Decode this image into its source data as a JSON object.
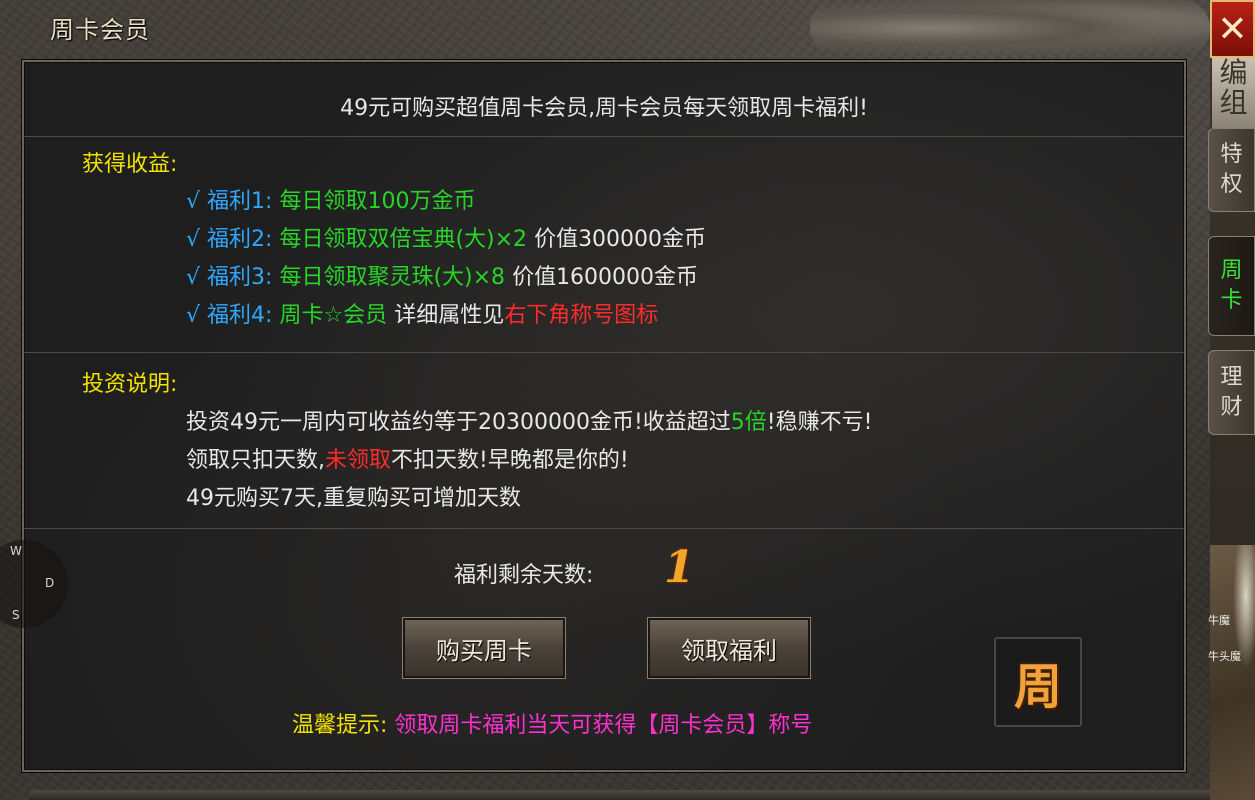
{
  "window": {
    "title": "周卡会员",
    "close_label": "✕"
  },
  "headline": "49元可购买超值周卡会员,周卡会员每天领取周卡福利!",
  "benefits": {
    "title": "获得收益:",
    "items": [
      {
        "check": "√",
        "label": "福利1:",
        "desc": "每日领取100万金币",
        "extra": "",
        "extra_red": ""
      },
      {
        "check": "√",
        "label": "福利2:",
        "desc": "每日领取双倍宝典(大)×2",
        "extra": "价值300000金币",
        "extra_red": ""
      },
      {
        "check": "√",
        "label": "福利3:",
        "desc": "每日领取聚灵珠(大)×8",
        "extra": "价值1600000金币",
        "extra_red": ""
      },
      {
        "check": "√",
        "label": "福利4:",
        "desc": "周卡☆会员",
        "extra": "详细属性见",
        "extra_red": "右下角称号图标"
      }
    ]
  },
  "investment": {
    "title": "投资说明:",
    "line1_a": "投资49元一周内可收益约等于20300000金币!收益超过",
    "line1_b": "5倍",
    "line1_c": "!稳赚不亏!",
    "line2_a": "领取只扣天数,",
    "line2_b": "未领取",
    "line2_c": "不扣天数!早晚都是你的!",
    "line3": "49元购买7天,重复购买可增加天数"
  },
  "days": {
    "label": "福利剩余天数:",
    "value": "1"
  },
  "buttons": {
    "buy": "购买周卡",
    "claim": "领取福利"
  },
  "tip": {
    "label": "温馨提示:",
    "text": "领取周卡福利当天可获得【周卡会员】称号"
  },
  "badge": "周",
  "side_tabs": [
    {
      "label_1": "编",
      "label_2": "组"
    },
    {
      "label_1": "特",
      "label_2": "权"
    },
    {
      "label_1": "周",
      "label_2": "卡"
    },
    {
      "label_1": "理",
      "label_2": "财"
    }
  ],
  "minimap": {
    "label_1": "牛魔",
    "label_2": "牛头魔"
  },
  "compass": {
    "n": "W",
    "e": "D",
    "s": "S"
  },
  "colors": {
    "title_yellow": "#f2e200",
    "benefit_blue": "#2ea8ff",
    "benefit_green": "#26d626",
    "highlight_red": "#ff2a2a",
    "tip_magenta": "#ff2fd0",
    "days_orange": "#f4a62a",
    "close_red": "#b82218"
  }
}
